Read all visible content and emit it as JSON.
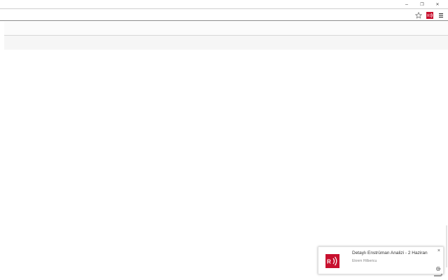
{
  "window": {
    "minimize_glyph": "–",
    "restore_glyph": "❐",
    "close_glyph": "✕"
  },
  "toolbar": {
    "icons": [
      "bookmark-star-icon",
      "extension-radio-icon",
      "menu-icon"
    ]
  },
  "notification": {
    "title": "Detaylı Enstrüman Analizi - 2 Haziran",
    "source": "Ekrem Hilbericu",
    "close_glyph": "×",
    "icon": "radio-broadcast-icon",
    "accent_color": "#c8102e"
  },
  "colors": {
    "accent": "#c8102e",
    "toolbar_border": "#8a8a8a"
  }
}
